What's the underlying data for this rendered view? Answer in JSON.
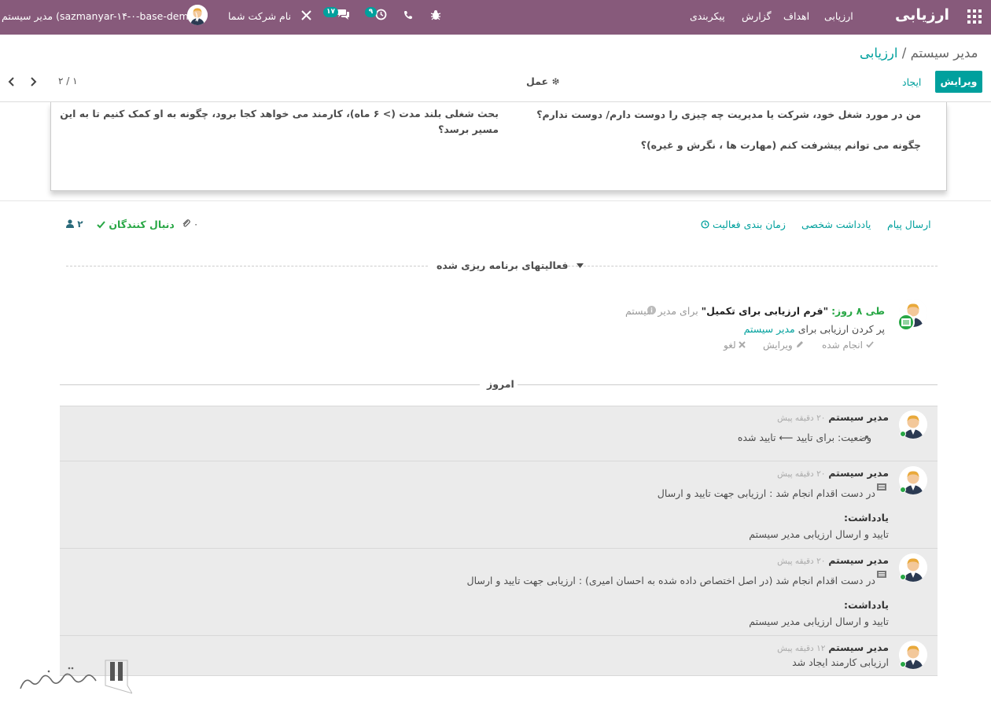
{
  "navbar": {
    "brand": "ارزیابی",
    "menu": [
      "ارزیابی",
      "اهداف",
      "گزارش",
      "پیکربندی"
    ],
    "user": "مدیر سیستم (sazmanyar-۱۴-۰-base-demo)",
    "company": "نام شرکت شما",
    "messages_badge": "۱۷",
    "activities_badge": "۹"
  },
  "control": {
    "breadcrumb_root": "ارزیابی",
    "breadcrumb_sep": "/",
    "breadcrumb_current": "مدیر سیستم",
    "edit_label": "ویرایش",
    "create_label": "ایجاد",
    "action_label": "عمل",
    "pager": "۲ / ۱"
  },
  "sheet": {
    "q1": "من در مورد شغل خود، شرکت یا مدیریت چه چیزی را دوست دارم/ دوست ندارم؟",
    "q2": "چگونه می توانم پیشرفت کنم (مهارت ها ، نگرش و غیره)؟",
    "q3_line1": "بحث شغلی بلند مدت (> ۶ ماه)، کارمند می خواهد کجا برود، چگونه به او کمک کنیم تا به این",
    "q3_line2": "مسیر برسد؟"
  },
  "chatter": {
    "send_message": "ارسال پیام",
    "log_note": "یادداشت شخصی",
    "schedule_activity": "زمان بندی فعالیت",
    "attachments": "۰",
    "following": "دنبال کنندگان",
    "followers_count": "۲",
    "planned_header": "فعالیتهای برنامه ریزی شده",
    "activity": {
      "due": "طی ۸ روز:",
      "summary": "\"فرم ارزیابی برای تکمیل\"",
      "for_label": "برای مدیر سیستم",
      "note_prefix": "پر کردن ارزیابی برای",
      "note_link": "مدیر سیستم",
      "done": "انجام شده",
      "edit": "ویرایش",
      "cancel": "لغو"
    },
    "today": "امروز",
    "messages": [
      {
        "author": "مدیر سیستم",
        "ago": "۲۰ دقیقه پیش",
        "text": "وضعیت: برای تایید ⟵ تایید شده"
      },
      {
        "author": "مدیر سیستم",
        "ago": "۲۰ دقیقه پیش",
        "text": "در دست اقدام انجام شد : ارزیابی جهت تایید و ارسال",
        "note_label": "یادداشت:",
        "note": "تایید و ارسال ارزیابی مدیر سیستم"
      },
      {
        "author": "مدیر سیستم",
        "ago": "۲۰ دقیقه پیش",
        "text": "در دست اقدام انجام شد (در اصل اختصاص داده شده به احسان امیری) : ارزیابی جهت تایید و ارسال",
        "note_label": "یادداشت:",
        "note": "تایید و ارسال ارزیابی مدیر سیستم"
      },
      {
        "author": "مدیر سیستم",
        "ago": "۱۲ دقیقه پیش",
        "text": "ارزیابی کارمند ایجاد شد"
      }
    ]
  },
  "colors": {
    "navbar": "#875a7b",
    "primary": "#00a09d",
    "success": "#28a745"
  }
}
